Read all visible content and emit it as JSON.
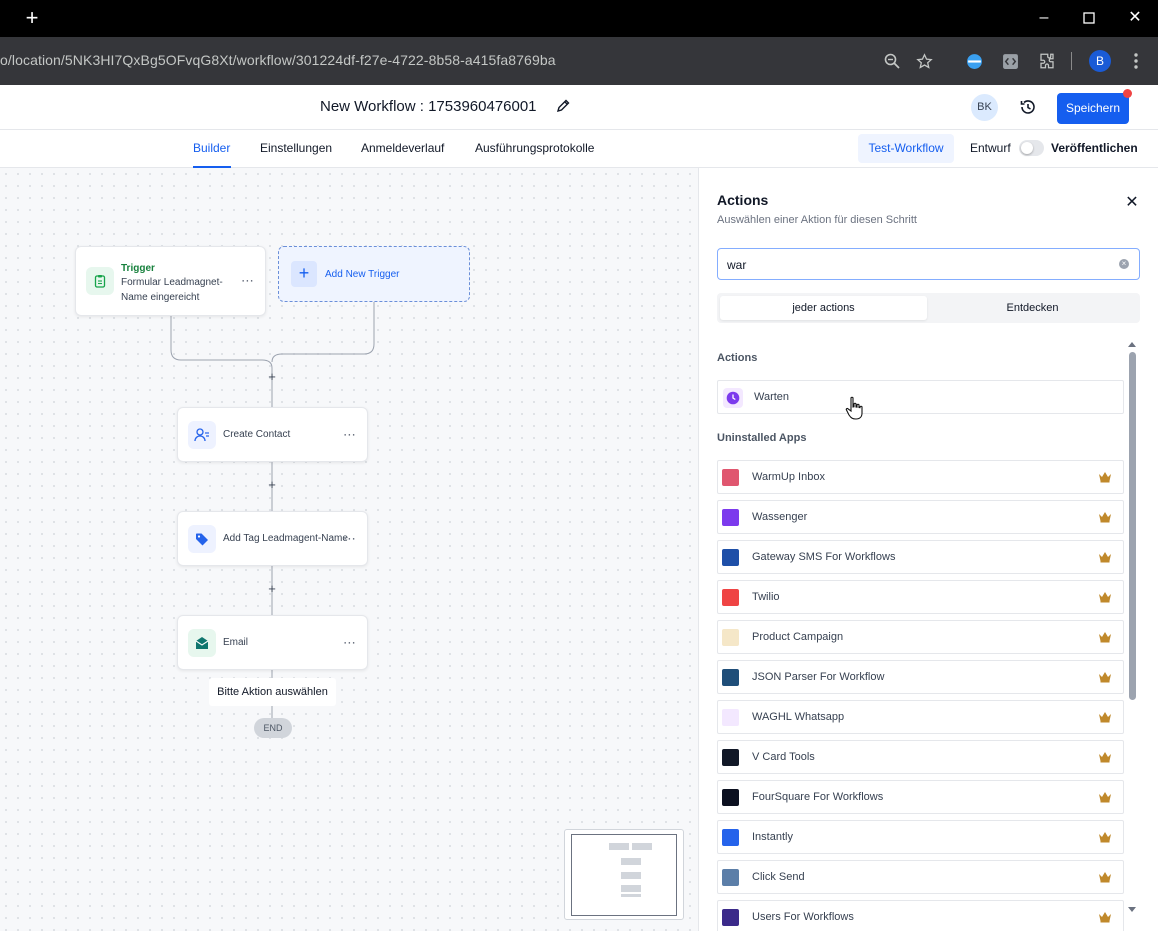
{
  "browser": {
    "url": "o/location/5NK3HI7QxBg5OFvqG8Xt/workflow/301224df-f27e-4722-8b58-a415fa8769ba",
    "profile_initial": "B",
    "new_tab": "+"
  },
  "header": {
    "workflow_title": "New Workflow : 1753960476001",
    "avatar_initials": "BK",
    "save_label": "Speichern"
  },
  "tabs": {
    "items": [
      "Builder",
      "Einstellungen",
      "Anmeldeverlauf",
      "Ausführungsprotokolle"
    ],
    "active": "Builder",
    "test_workflow": "Test-Workflow",
    "draft_label": "Entwurf",
    "publish_label": "Veröffentlichen"
  },
  "canvas": {
    "trigger": {
      "title": "Trigger",
      "line1": "Formular Leadmagnet-",
      "line2": "Name eingereicht"
    },
    "add_trigger": "Add New Trigger",
    "nodes": [
      "Create Contact",
      "Add Tag Leadmagent-Name",
      "Email"
    ],
    "tooltip": "Bitte Aktion auswählen",
    "end_label": "END"
  },
  "panel": {
    "title": "Actions",
    "subtitle": "Auswählen einer Aktion für diesen Schritt",
    "search_value": "war",
    "seg_tabs": [
      "jeder actions",
      "Entdecken"
    ],
    "section_actions": "Actions",
    "warten": "Warten",
    "section_uninstalled": "Uninstalled Apps",
    "apps": [
      "WarmUp Inbox",
      "Wassenger",
      "Gateway SMS For Workflows",
      "Twilio",
      "Product Campaign",
      "JSON Parser For Workflow",
      "WAGHL Whatsapp",
      "V Card Tools",
      "FourSquare For Workflows",
      "Instantly",
      "Click Send",
      "Users For Workflows"
    ],
    "app_colors": [
      "#e0566f",
      "#7c3aed",
      "#1e4fa8",
      "#ef4444",
      "#f5e7c8",
      "#1f4e79",
      "#f3e8ff",
      "#111827",
      "#0b1020",
      "#2563eb",
      "#5b7ea8",
      "#3b2a8a"
    ]
  }
}
